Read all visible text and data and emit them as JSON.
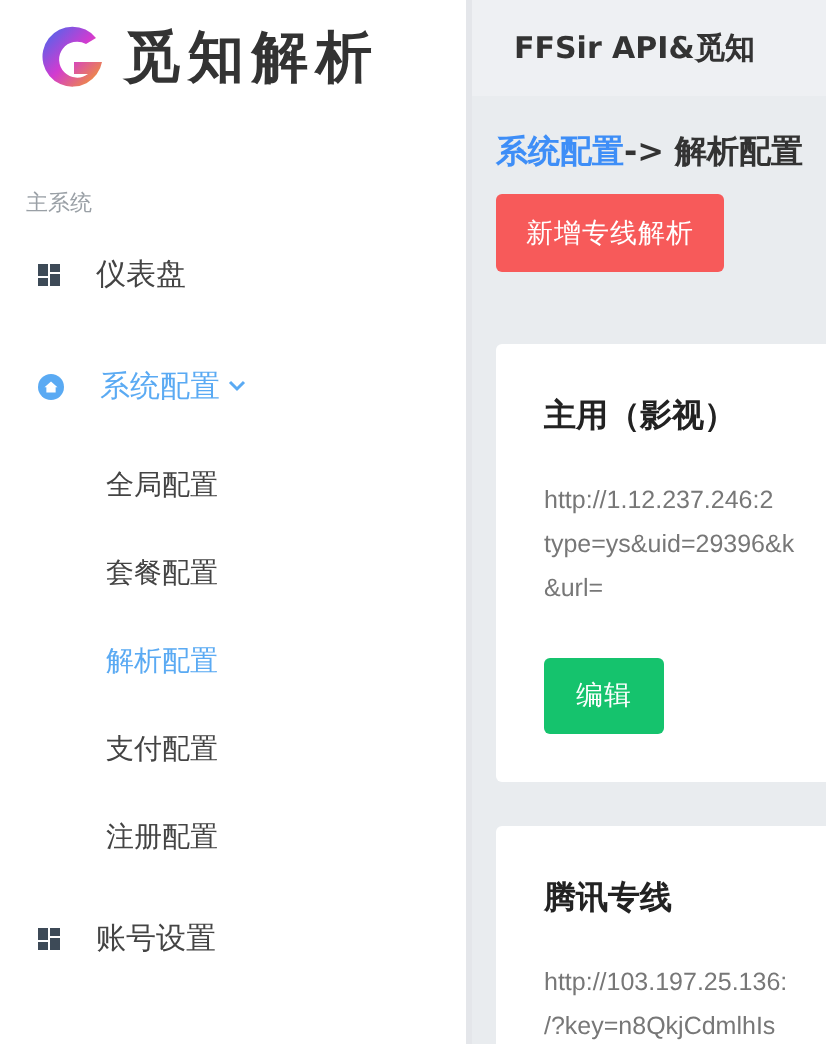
{
  "brand": {
    "name": "觅知解析"
  },
  "header": {
    "title": "FFSir API&觅知"
  },
  "sidebar": {
    "section_label": "主系统",
    "items": [
      {
        "label": "仪表盘",
        "kind": "link",
        "selected": false
      },
      {
        "label": "系统配置",
        "kind": "group",
        "selected": true,
        "expanded": true,
        "children": [
          {
            "label": "全局配置",
            "selected": false
          },
          {
            "label": "套餐配置",
            "selected": false
          },
          {
            "label": "解析配置",
            "selected": true
          },
          {
            "label": "支付配置",
            "selected": false
          },
          {
            "label": "注册配置",
            "selected": false
          }
        ]
      },
      {
        "label": "账号设置",
        "kind": "link",
        "selected": false
      }
    ]
  },
  "breadcrumb": {
    "parent": "系统配置",
    "separator": "->",
    "current": "解析配置"
  },
  "add_button": "新增专线解析",
  "cards": [
    {
      "title": "主用（影视）",
      "lines": [
        "http://1.12.237.246:2",
        "type=ys&uid=29396&k",
        "&url="
      ],
      "button": "编辑"
    },
    {
      "title": "腾讯专线",
      "lines": [
        "http://103.197.25.136:",
        "/?key=n8QkjCdmlhIs"
      ]
    }
  ]
}
